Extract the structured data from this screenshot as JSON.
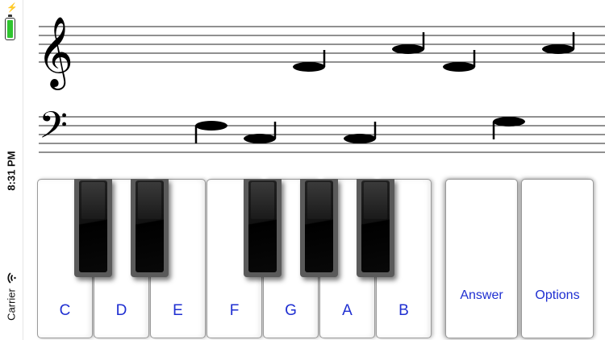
{
  "status": {
    "time": "8:31 PM",
    "carrier": "Carrier",
    "battery_color": "#2fc52f"
  },
  "staves": {
    "treble_clef": "𝄞",
    "bass_clef": "𝄢"
  },
  "keyboard": {
    "white_keys": [
      {
        "label": "C"
      },
      {
        "label": "D"
      },
      {
        "label": "E"
      },
      {
        "label": "F"
      },
      {
        "label": "G"
      },
      {
        "label": "A"
      },
      {
        "label": "B"
      }
    ]
  },
  "buttons": {
    "answer": "Answer",
    "options": "Options"
  },
  "colors": {
    "key_label": "#1f2fd1",
    "note": "#000000"
  }
}
